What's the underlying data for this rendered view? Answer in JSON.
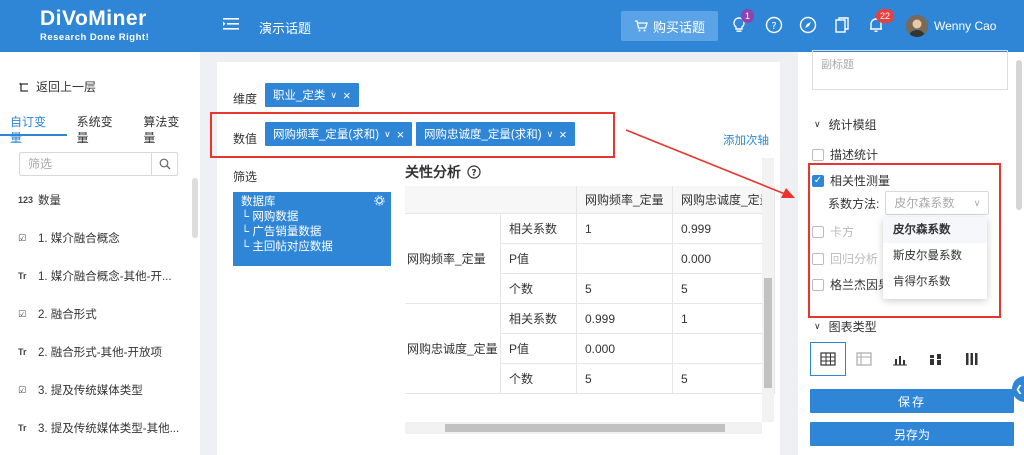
{
  "header": {
    "logo_main": "DiVoMiner",
    "logo_sub": "Research Done Right!",
    "project_title": "演示话题",
    "buy_label": "购买话题",
    "bulb_badge": "1",
    "bell_badge": "22",
    "user_name": "Wenny Cao"
  },
  "left": {
    "back_label": "返回上一层",
    "tabs": [
      "自订变量",
      "系统变量",
      "算法变量"
    ],
    "filter_placeholder": "筛选",
    "items": [
      {
        "icon": "123",
        "label": "数量"
      },
      {
        "icon": "☑",
        "label": "1. 媒介融合概念"
      },
      {
        "icon": "Tr",
        "label": "1. 媒介融合概念-其他-开..."
      },
      {
        "icon": "☑",
        "label": "2. 融合形式"
      },
      {
        "icon": "Tr",
        "label": "2. 融合形式-其他-开放项"
      },
      {
        "icon": "☑",
        "label": "3. 提及传统媒体类型"
      },
      {
        "icon": "Tr",
        "label": "3. 提及传统媒体类型-其他..."
      }
    ]
  },
  "center": {
    "dimension_label": "维度",
    "dimension_chip": "职业_定类",
    "value_label": "数值",
    "value_chips": [
      "网购频率_定量(求和)",
      "网购忠诚度_定量(求和)"
    ],
    "add_axis": "添加次轴",
    "filter_label": "筛选",
    "db": {
      "title": "数据库",
      "items": [
        "网购数据",
        "广告销量数据",
        "主回帖对应数据"
      ]
    },
    "result_title": "关性分析",
    "table": {
      "headers": [
        "网购频率_定量",
        "网购忠诚度_定量"
      ],
      "groups": [
        {
          "name": "网购频率_定量",
          "rows": [
            {
              "stat": "相关系数",
              "v1": "1",
              "v2": "0.999"
            },
            {
              "stat": "P值",
              "v1": "",
              "v2": "0.000"
            },
            {
              "stat": "个数",
              "v1": "5",
              "v2": "5"
            }
          ]
        },
        {
          "name": "网购忠诚度_定量",
          "rows": [
            {
              "stat": "相关系数",
              "v1": "0.999",
              "v2": "1"
            },
            {
              "stat": "P值",
              "v1": "0.000",
              "v2": ""
            },
            {
              "stat": "个数",
              "v1": "5",
              "v2": "5"
            }
          ]
        }
      ]
    }
  },
  "right": {
    "subtitle_placeholder": "副标题",
    "stats_section": "统计模组",
    "descriptive": "描述统计",
    "correlation": "相关性测量",
    "method_label": "系数方法:",
    "method_placeholder": "皮尔森系数",
    "method_options": [
      "皮尔森系数",
      "斯皮尔曼系数",
      "肯得尔系数"
    ],
    "chi": "卡方",
    "regression": "回归分析",
    "granger": "格兰杰因果",
    "chart_section": "图表类型",
    "save": "保存",
    "save_as": "另存为"
  },
  "colors": {
    "brand": "#2f86d6",
    "highlight": "#e8362f"
  }
}
